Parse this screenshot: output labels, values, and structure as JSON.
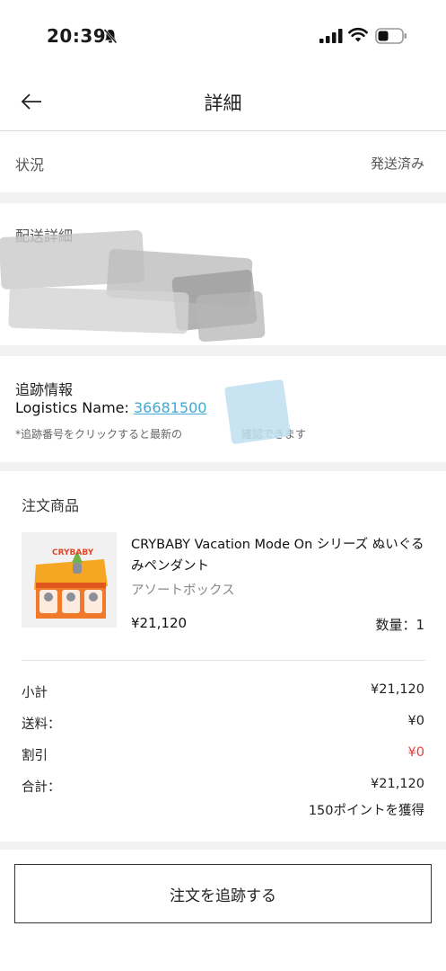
{
  "status_bar": {
    "time": "20:39"
  },
  "nav": {
    "title": "詳細"
  },
  "status": {
    "label": "状況",
    "value": "発送済み"
  },
  "delivery": {
    "title": "配送詳細"
  },
  "tracking": {
    "title": "追跡情報",
    "logistics_label": "Logistics Name:",
    "tracking_number_visible": "36681500",
    "note_start": "*追跡番号をクリックすると最新の",
    "note_end": "確認できます"
  },
  "order": {
    "title": "注文商品",
    "product": {
      "name": "CRYBABY Vacation Mode On シリーズ ぬいぐるみペンダント",
      "variant": "アソートボックス",
      "price": "¥21,120",
      "quantity": "数量：1",
      "box_label": "CRYBABY"
    },
    "summary": {
      "subtotal_label": "小計",
      "subtotal_value": "¥21,120",
      "shipping_label": "送料：",
      "shipping_value": "¥0",
      "discount_label": "割引",
      "discount_value": "¥0",
      "total_label": "合計：",
      "total_value": "¥21,120",
      "points": "150ポイントを獲得"
    }
  },
  "actions": {
    "track_order": "注文を追跡する"
  },
  "colors": {
    "link": "#3fa9d6",
    "discount": "#e04040",
    "section_gap": "#f2f2f2"
  }
}
